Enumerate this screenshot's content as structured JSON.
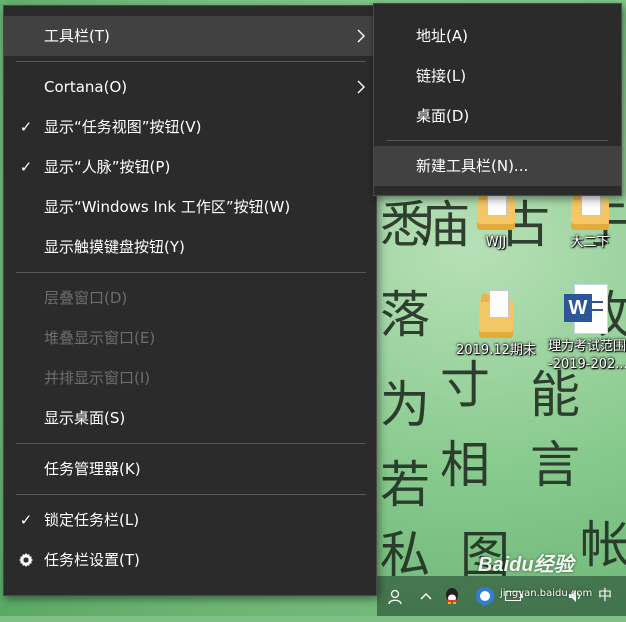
{
  "context_menu": {
    "items": [
      {
        "label": "工具栏(T)"
      },
      {
        "label": "Cortana(O)"
      },
      {
        "label": "显示“任务视图”按钮(V)"
      },
      {
        "label": "显示“人脉”按钮(P)"
      },
      {
        "label": "显示“Windows Ink 工作区”按钮(W)"
      },
      {
        "label": "显示触摸键盘按钮(Y)"
      },
      {
        "label": "层叠窗口(D)"
      },
      {
        "label": "堆叠显示窗口(E)"
      },
      {
        "label": "并排显示窗口(I)"
      },
      {
        "label": "显示桌面(S)"
      },
      {
        "label": "任务管理器(K)"
      },
      {
        "label": "锁定任务栏(L)"
      },
      {
        "label": "任务栏设置(T)"
      }
    ]
  },
  "submenu": {
    "items": [
      {
        "label": "地址(A)"
      },
      {
        "label": "链接(L)"
      },
      {
        "label": "桌面(D)"
      },
      {
        "label": "新建工具栏(N)..."
      }
    ]
  },
  "desktop": {
    "icons": [
      {
        "label": "WJJ",
        "type": "folder"
      },
      {
        "label": "大二下",
        "type": "folder"
      },
      {
        "label": "2019.12期末",
        "type": "folder"
      },
      {
        "label": "理力考试范围\n-2019-202...",
        "type": "word-document"
      }
    ],
    "wallpaper_chars": [
      "庙",
      "于",
      "寸",
      "能",
      "相",
      "言",
      "故",
      "为",
      "图",
      "若",
      "私",
      "悉",
      "落",
      "古",
      "帐"
    ]
  },
  "taskbar": {
    "ime_label": "中",
    "icons": [
      "people-icon",
      "chevron-up-icon",
      "qq-icon",
      "network-icon",
      "battery-icon",
      "volume-icon"
    ]
  },
  "watermark": {
    "text": "Baidu经验",
    "sub": "jingyan.baidu.com"
  },
  "colors": {
    "menu_bg": "#2b2b2b",
    "menu_highlight": "#414141",
    "menu_text": "#ffffff",
    "menu_disabled": "#6d6d6d",
    "separator": "#595959"
  }
}
